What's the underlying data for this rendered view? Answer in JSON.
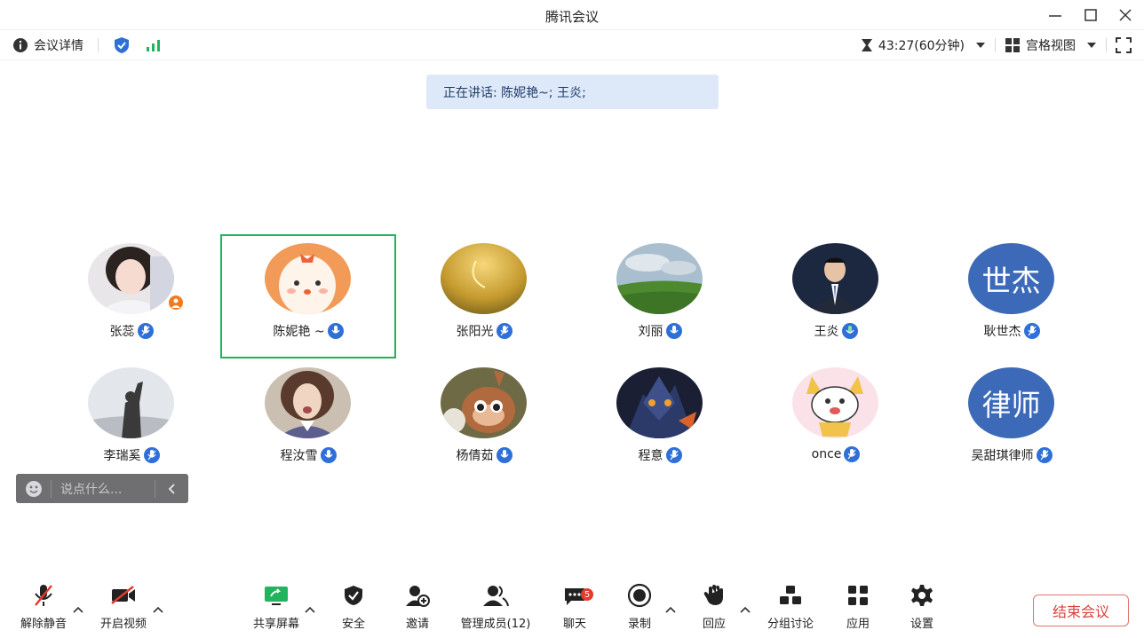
{
  "window": {
    "title": "腾讯会议"
  },
  "infobar": {
    "details_label": "会议详情",
    "timer": "43:27(60分钟)",
    "view_label": "宫格视图"
  },
  "speaking": {
    "text": "正在讲话: 陈妮艳~; 王炎;"
  },
  "participants": [
    {
      "name": "张蕊",
      "avatar_text": ""
    },
    {
      "name": "陈妮艳 ~",
      "avatar_text": ""
    },
    {
      "name": "张阳光",
      "avatar_text": ""
    },
    {
      "name": "刘丽",
      "avatar_text": ""
    },
    {
      "name": "王炎",
      "avatar_text": ""
    },
    {
      "name": "耿世杰",
      "avatar_text": "世杰"
    },
    {
      "name": "李瑞奚",
      "avatar_text": ""
    },
    {
      "name": "程汝雪",
      "avatar_text": ""
    },
    {
      "name": "杨倩茹",
      "avatar_text": ""
    },
    {
      "name": "程意",
      "avatar_text": ""
    },
    {
      "name": "once",
      "avatar_text": ""
    },
    {
      "name": "吴甜琪律师",
      "avatar_text": "律师"
    }
  ],
  "chat_input": {
    "placeholder": "说点什么..."
  },
  "toolbar": {
    "unmute": "解除静音",
    "start_video": "开启视频",
    "share_screen": "共享屏幕",
    "security": "安全",
    "invite": "邀请",
    "manage_members": "管理成员(12)",
    "chat": "聊天",
    "chat_badge": "5",
    "record": "录制",
    "react": "回应",
    "breakout": "分组讨论",
    "apps": "应用",
    "settings": "设置",
    "end_meeting": "结束会议"
  },
  "colors": {
    "accent_blue": "#2f6fd8",
    "active_green": "#22b35e",
    "end_red": "#d9423b"
  }
}
